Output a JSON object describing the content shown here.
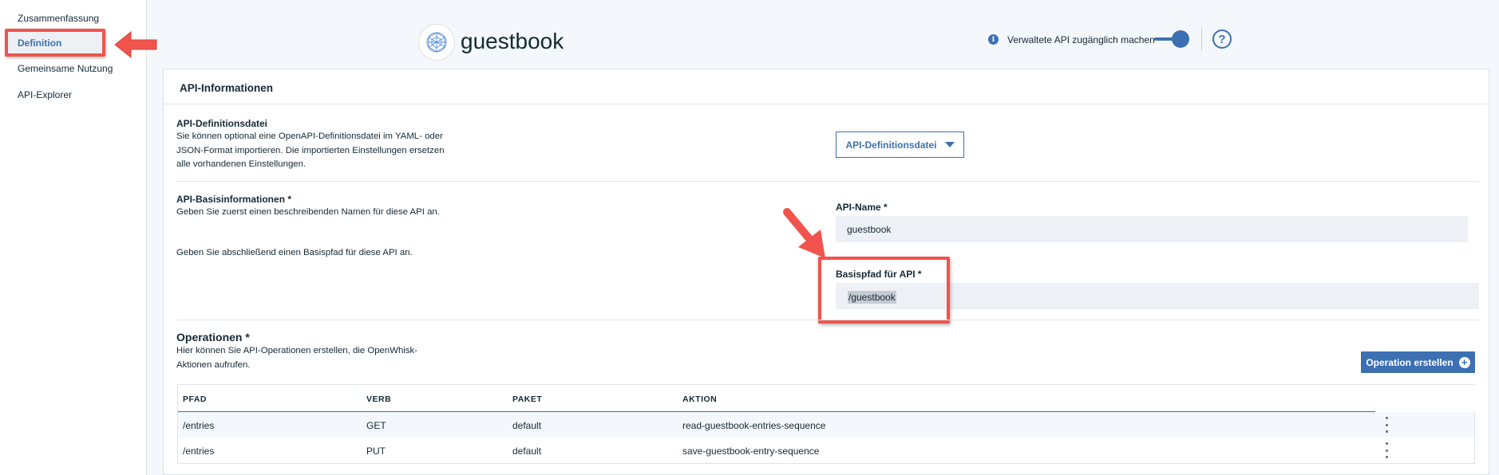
{
  "sidebar": {
    "items": [
      {
        "label": "Zusammenfassung"
      },
      {
        "label": "Definition",
        "active": true
      },
      {
        "label": "Gemeinsame Nutzung"
      },
      {
        "label": "API-Explorer"
      }
    ]
  },
  "header": {
    "title": "guestbook",
    "toggle_label": "Verwaltete API zugänglich machen",
    "toggle_on": true,
    "info_icon": "info-icon",
    "help_icon": "help-icon",
    "help_glyph": "?",
    "info_glyph": "i"
  },
  "panel": {
    "title": "API-Informationen",
    "definition_file": {
      "title": "API-Definitionsdatei",
      "description": "Sie können optional eine OpenAPI-Definitionsdatei im YAML- oder JSON-Format importieren. Die importierten Einstellungen ersetzen alle vorhandenen Einstellungen.",
      "button_label": "API-Definitionsdatei"
    },
    "basic_info": {
      "title": "API-Basisinformationen *",
      "desc_name": "Geben Sie zuerst einen beschreibenden Namen für diese API an.",
      "desc_path": "Geben Sie abschließend einen Basispfad für diese API an.",
      "name_label": "API-Name *",
      "name_value": "guestbook",
      "path_label": "Basispfad für API *",
      "path_value": "/guestbook"
    },
    "operations": {
      "title": "Operationen *",
      "description": "Hier können Sie API-Operationen erstellen, die OpenWhisk-Aktionen aufrufen.",
      "create_button": "Operation erstellen",
      "columns": [
        "PFAD",
        "VERB",
        "PAKET",
        "AKTION"
      ],
      "rows": [
        {
          "path": "/entries",
          "verb": "GET",
          "package": "default",
          "action": "read-guestbook-entries-sequence"
        },
        {
          "path": "/entries",
          "verb": "PUT",
          "package": "default",
          "action": "save-guestbook-entry-sequence"
        }
      ]
    }
  },
  "colors": {
    "accent": "#3d70b2",
    "annotation": "#f0544c"
  }
}
